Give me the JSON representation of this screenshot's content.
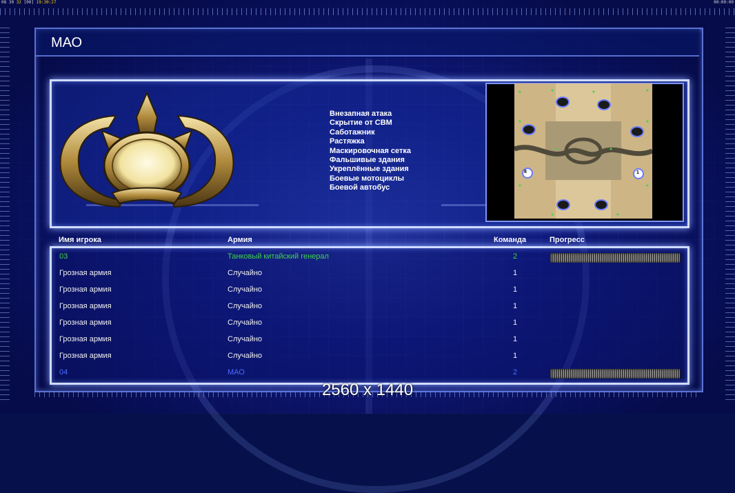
{
  "status_bar": {
    "left_prefix": "08 30",
    "left_highlight": "32",
    "left_mid": "[00]",
    "left_time": "19:30:27",
    "right_time": "00:00:00"
  },
  "screen": {
    "title": "МАО"
  },
  "rules": [
    "Внезапная атака",
    "Скрытие от СВМ",
    "Саботажник",
    "Растяжка",
    "Маскировочная сетка",
    "Фальшивые здания",
    "Укреплённые здания",
    "Боевые мотоциклы",
    "Боевой автобус"
  ],
  "map": {
    "start_labels": [
      "8",
      "1"
    ]
  },
  "table": {
    "headers": {
      "player": "Имя игрока",
      "army": "Армия",
      "team": "Команда",
      "progress": "Прогресс"
    },
    "rows": [
      {
        "name": "03",
        "army": "Танковый китайский генерал",
        "team": "2",
        "style": "green",
        "progress": 1
      },
      {
        "name": "Грозная армия",
        "army": "Случайно",
        "team": "1",
        "style": "white"
      },
      {
        "name": "Грозная армия",
        "army": "Случайно",
        "team": "1",
        "style": "white"
      },
      {
        "name": "Грозная армия",
        "army": "Случайно",
        "team": "1",
        "style": "white"
      },
      {
        "name": "Грозная армия",
        "army": "Случайно",
        "team": "1",
        "style": "white"
      },
      {
        "name": "Грозная армия",
        "army": "Случайно",
        "team": "1",
        "style": "white"
      },
      {
        "name": "Грозная армия",
        "army": "Случайно",
        "team": "1",
        "style": "white"
      },
      {
        "name": "04",
        "army": "МАО",
        "team": "2",
        "style": "blue",
        "progress": 1
      }
    ]
  },
  "overlay": {
    "resolution": "2560 x 1440"
  },
  "colors": {
    "ally_text": "#3fd64a",
    "self_text": "#4a6cff",
    "panel_border": "#d0dcff"
  }
}
